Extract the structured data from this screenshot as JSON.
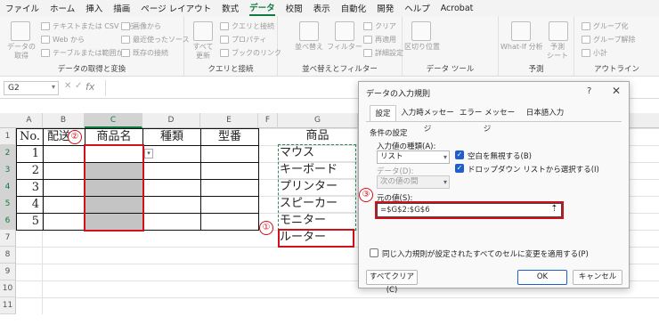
{
  "menu": {
    "tabs": [
      "ファイル",
      "ホーム",
      "挿入",
      "描画",
      "ページ レイアウト",
      "数式",
      "データ",
      "校閲",
      "表示",
      "自動化",
      "開発",
      "ヘルプ",
      "Acrobat"
    ],
    "active_tab": "データ"
  },
  "ribbon": {
    "get_data": {
      "big_label": "データの\n取得",
      "items": [
        "テキストまたは CSV から",
        "Web から",
        "テーブルまたは範囲から",
        "画像から",
        "最近使ったソース",
        "既存の接続"
      ],
      "group_label": "データの取得と変換"
    },
    "queries": {
      "big_label": "すべて\n更新",
      "items": [
        "クエリと接続",
        "プロパティ",
        "ブックのリンク"
      ],
      "group_label": "クエリと接続"
    },
    "sort_filter": {
      "items": [
        "並べ替え",
        "フィルター",
        "クリア",
        "再適用",
        "詳細設定"
      ],
      "group_label": "並べ替えとフィルター"
    },
    "data_tools": {
      "items": [
        "区切り位置"
      ],
      "group_label": "データ ツール"
    },
    "forecast": {
      "items": [
        "What-If 分析",
        "予測\nシート"
      ],
      "group_label": "予測"
    },
    "outline": {
      "items": [
        "グループ化",
        "グループ解除",
        "小計"
      ],
      "group_label": "アウトライン"
    }
  },
  "formula_bar": {
    "name_box": "G2",
    "fx": "fx",
    "value": ""
  },
  "grid": {
    "columns": [
      "A",
      "B",
      "C",
      "D",
      "E",
      "F",
      "G"
    ],
    "selected_column": "C",
    "rows": [
      "1",
      "2",
      "3",
      "4",
      "5",
      "6",
      "7",
      "8",
      "9",
      "10",
      "11"
    ],
    "table_headers": [
      "No.",
      "配送",
      "商品名",
      "種類",
      "型番"
    ],
    "numbers": [
      "1",
      "2",
      "3",
      "4",
      "5"
    ],
    "list_header": "商品",
    "list_items": [
      "マウス",
      "キーボード",
      "プリンター",
      "スピーカー",
      "モニター",
      "ルーター"
    ]
  },
  "callouts": [
    "①",
    "②",
    "③"
  ],
  "dialog": {
    "title": "データの入力規則",
    "help": "?",
    "close": "✕",
    "tabs": [
      "設定",
      "入力時メッセージ",
      "エラー メッセージ",
      "日本語入力"
    ],
    "active_tab": "設定",
    "section": "条件の設定",
    "allow_label": "入力値の種類(A):",
    "allow_value": "リスト",
    "ignore_blank": "空白を無視する(B)",
    "in_cell_dropdown": "ドロップダウン リストから選択する(I)",
    "data_label": "データ(D):",
    "data_value": "次の値の間",
    "source_label": "元の値(S):",
    "source_value": "=$G$2:$G$6",
    "apply_all": "同じ入力規則が設定されたすべてのセルに変更を適用する(P)",
    "clear_all": "すべてクリア(C)",
    "ok": "OK",
    "cancel": "キャンセル"
  },
  "colors": {
    "accent": "#107c41",
    "highlight_red": "#d0101a",
    "checkbox_blue": "#1e5fcc",
    "selected_fill": "#c4c4c4"
  }
}
